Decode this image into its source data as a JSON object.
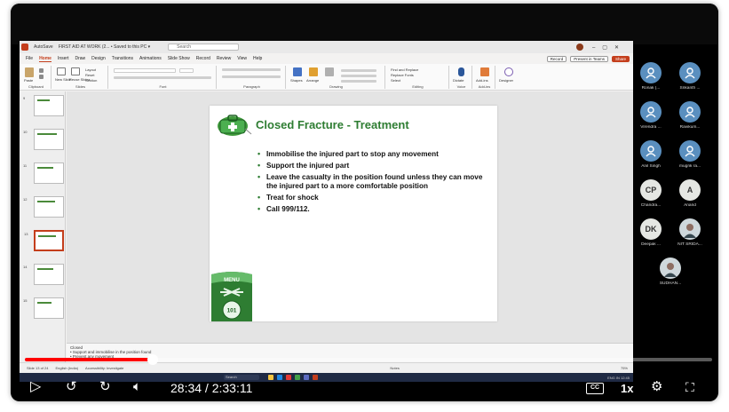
{
  "window": {
    "autosave_label": "AutoSave",
    "title": "FIRST AID AT WORK (2... • Saved to this PC ▾",
    "search_placeholder": "Search"
  },
  "menubar": {
    "tabs": [
      "File",
      "Home",
      "Insert",
      "Draw",
      "Design",
      "Transitions",
      "Animations",
      "Slide Show",
      "Record",
      "Review",
      "View",
      "Help"
    ],
    "active_tab": "Home",
    "record_label": "Record",
    "present_label": "Present in Teams",
    "share_label": "Share"
  },
  "ribbon": {
    "groups": [
      "Clipboard",
      "Slides",
      "Font",
      "Paragraph",
      "Drawing",
      "Editing",
      "Voice",
      "Add-ins"
    ],
    "paste": "Paste",
    "new_slide": "New Slide",
    "reuse_slides": "Reuse Slides",
    "layout": "Layout",
    "reset": "Reset",
    "section": "Section",
    "shapes": "Shapes",
    "arrange": "Arrange",
    "find_replace": "Find and Replace",
    "replace_fonts": "Replace Fonts",
    "select": "Select",
    "dictate": "Dictate",
    "add_ins": "Add-ins",
    "designer": "Designer"
  },
  "thumbnails": [
    {
      "num": "9",
      "active": false
    },
    {
      "num": "10",
      "active": false
    },
    {
      "num": "11",
      "active": false
    },
    {
      "num": "12",
      "active": false
    },
    {
      "num": "13",
      "active": true
    },
    {
      "num": "14",
      "active": false
    },
    {
      "num": "15",
      "active": false
    }
  ],
  "slide": {
    "title": "Closed Fracture - Treatment",
    "bullets": [
      "Immobilise the injured part to stop any movement",
      "Support the injured part",
      "Leave the casualty in the position found unless they can move the injured part to a more comfortable position",
      "Treat for shock",
      "Call 999/112."
    ],
    "badge_top": "MENU",
    "badge_num": "101"
  },
  "notes": {
    "line1": "Closed",
    "line2": "• Support and immobilise in the position found",
    "line3": "• Prevent any movement"
  },
  "statusbar": {
    "slide_info": "Slide 13 of 24",
    "language": "English (India)",
    "accessibility": "Accessibility: Investigate",
    "notes_label": "Notes",
    "zoom": "75%"
  },
  "participants": [
    {
      "initials": "",
      "name": "Ronak (...",
      "style": "blue"
    },
    {
      "initials": "",
      "name": "Srikanth ...",
      "style": "blue"
    },
    {
      "initials": "",
      "name": "Virendra ...",
      "style": "blue"
    },
    {
      "initials": "",
      "name": "Ravikum...",
      "style": "blue"
    },
    {
      "initials": "",
      "name": "Anil Singh",
      "style": "blue"
    },
    {
      "initials": "",
      "name": "mugrik ra...",
      "style": "blue"
    },
    {
      "initials": "CP",
      "name": "Chandra...",
      "style": "lt"
    },
    {
      "initials": "A",
      "name": "Anand",
      "style": "lt"
    },
    {
      "initials": "DK",
      "name": "Deepak ...",
      "style": "lt"
    },
    {
      "initials": "",
      "name": "NIT SRIDA...",
      "style": "photo"
    },
    {
      "initials": "",
      "name": "SUDHAN...",
      "style": "photo"
    }
  ],
  "taskbar": {
    "search": "Search",
    "tray": "ENG IN  12:45"
  },
  "player": {
    "time": "28:34 / 2:33:11",
    "speed": "1x",
    "cc": "CC",
    "progress": 0.186
  }
}
